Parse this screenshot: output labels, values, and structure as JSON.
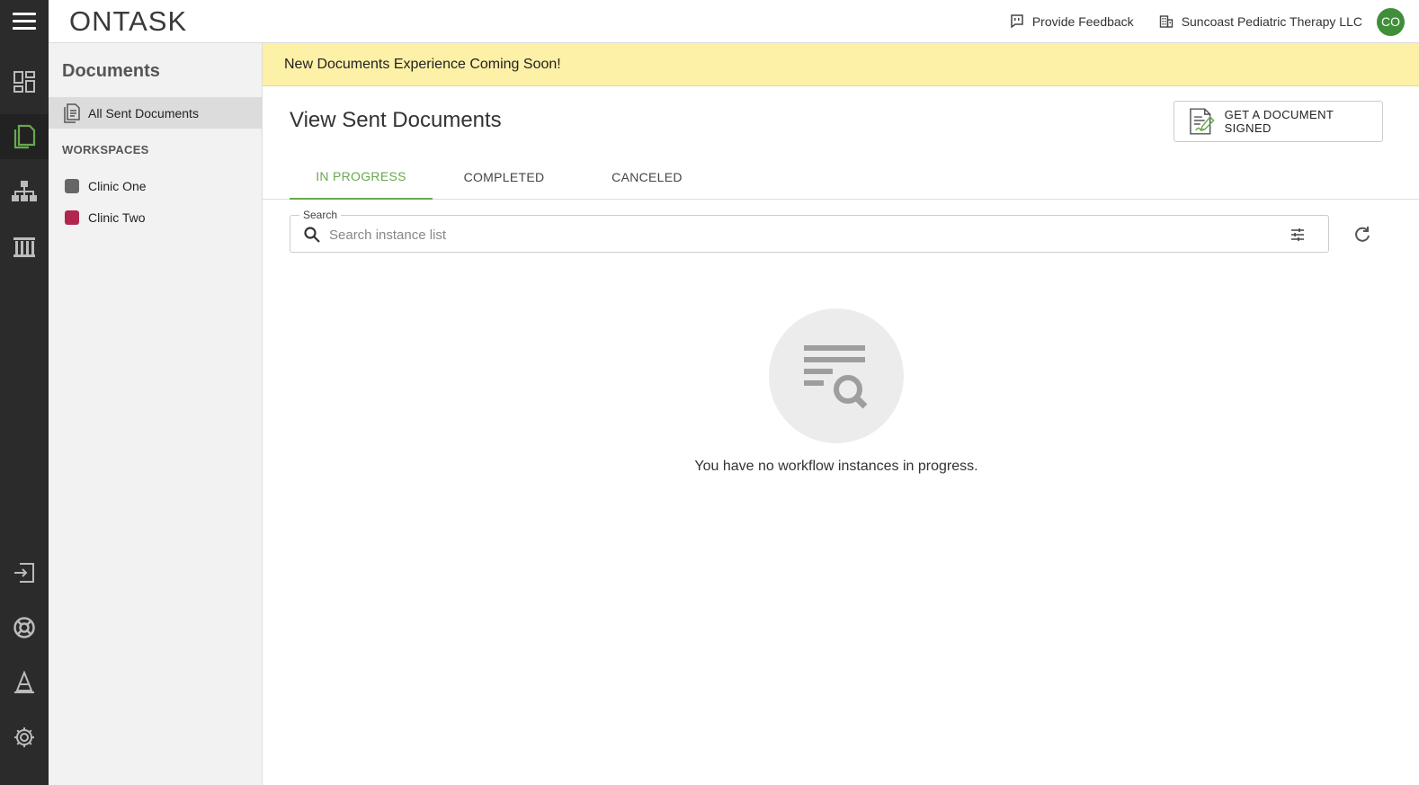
{
  "header": {
    "logo_text": "ONTASK",
    "feedback_label": "Provide Feedback",
    "org_name": "Suncoast Pediatric Therapy LLC",
    "avatar_initials": "CO"
  },
  "rail": {
    "items": [
      "dashboard-icon",
      "documents-icon",
      "workflows-icon",
      "library-icon",
      "logout-icon",
      "help-icon",
      "learning-icon",
      "settings-icon"
    ],
    "active": "documents-icon"
  },
  "sidebar": {
    "title": "Documents",
    "items": [
      {
        "label": "All Sent Documents"
      }
    ],
    "workspaces_heading": "WORKSPACES",
    "workspaces": [
      {
        "label": "Clinic One",
        "color": "#666666"
      },
      {
        "label": "Clinic Two",
        "color": "#b0264f"
      }
    ]
  },
  "banner": {
    "text": "New Documents Experience Coming Soon!"
  },
  "main": {
    "title": "View Sent Documents",
    "cta_label": "GET A DOCUMENT SIGNED",
    "tabs": [
      {
        "label": "IN PROGRESS",
        "active": true
      },
      {
        "label": "COMPLETED",
        "active": false
      },
      {
        "label": "CANCELED",
        "active": false
      }
    ],
    "search": {
      "label": "Search",
      "placeholder": "Search instance list",
      "value": ""
    },
    "empty_message": "You have no workflow instances in progress."
  },
  "colors": {
    "accent": "#6aa84f",
    "rail": "#2b2b2b",
    "banner": "#fdf0a7"
  }
}
